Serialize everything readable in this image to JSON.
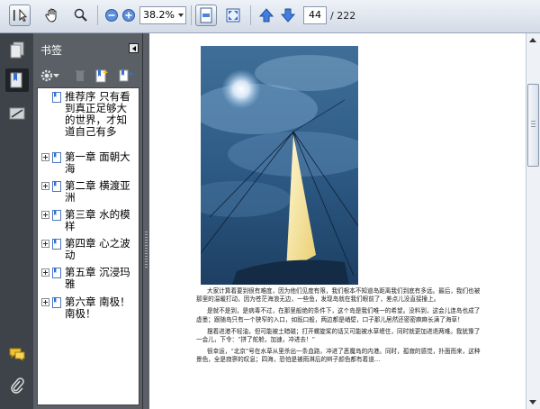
{
  "toolbar": {
    "zoom_value": "38.2%",
    "page_current": "44",
    "page_total": "/ 222"
  },
  "rail": {
    "items": [
      "pages-icon",
      "bookmarks-icon",
      "signatures-icon",
      "comments-icon",
      "attachments-icon"
    ]
  },
  "panel": {
    "title": "书签"
  },
  "bookmarks": [
    {
      "label": "推荐序 只有看到真正足够大的世界，才知道自己有多"
    },
    {
      "label": "第一章 面朝大海"
    },
    {
      "label": "第二章 横渡亚洲"
    },
    {
      "label": "第三章 水的模样"
    },
    {
      "label": "第四章 心之波动"
    },
    {
      "label": "第五章 沉浸玛雅"
    },
    {
      "label": "第六章 南极！南极！"
    }
  ],
  "document": {
    "paragraphs": [
      "大家计算着要到很有难度，因为他们见度有限，我们根本不知道岛距离我们到底有多远。最后，我们也被那里的温暖打动，因为苍茫海浪无边，一些鱼，发现岛就在我们眼前了，差点儿没直接撞上。",
      "是就不是到，是病毒不过，在那里般绝的条件下，这个岛是我们唯一的希望。没料到，这会儿连岛也成了虚墨；跟随岛只有一个狭窄的入口，如既口般，两边都是峭壁，口子那儿居然还密密麻麻长满了海草！",
      "摆着进港不轻油，但可能被土暗磁；打开螺旋桨的话又可能被水草缠住，同时就更加进退两难。我犹豫了一会儿，下令：“拼了舵舱，加速，冲进去！”",
      "很幸运，“北京”号在水草从里杀出一条血路，冲进了恶魔岛的内港。同时，孤寂的感觉，扑面而来，这种景色，全是寂寥的叹息；四海，恐怕是被雨淋后的辫子颜色都有着道…"
    ]
  },
  "colors": {
    "toolbar_bg": "#dfe5ee",
    "panel_bg": "#5a6066",
    "rail_bg": "#3d4348",
    "accent_blue": "#2f6fd6"
  }
}
